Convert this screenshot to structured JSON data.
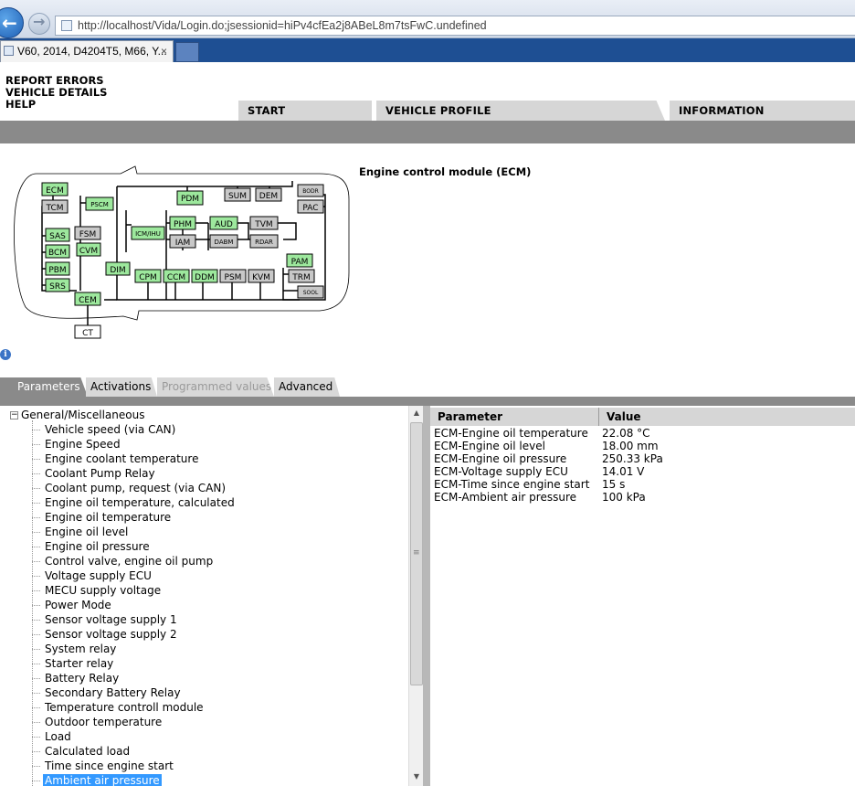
{
  "browser": {
    "url": "http://localhost/Vida/Login.do;jsessionid=hiPv4cfEa2j8ABeL8m7tsFwC.undefined",
    "tab_title": "V60, 2014, D4204T5, M66, Y...",
    "tab_close": "×"
  },
  "menu": {
    "report_errors": "REPORT ERRORS",
    "vehicle_details": "VEHICLE DETAILS",
    "help": "HELP"
  },
  "main_tabs": {
    "start": "START",
    "vehicle_profile": "VEHICLE PROFILE",
    "information": "INFORMATION"
  },
  "module_title": "Engine control module (ECM)",
  "diagram": {
    "modules": {
      "ecm": "ECM",
      "tcm": "TCM",
      "pscm": "PSCM",
      "pdm": "PDM",
      "sum": "SUM",
      "dem": "DEM",
      "bodr": "BODR",
      "pac": "PAC",
      "sas": "SAS",
      "fsm": "FSM",
      "bcm": "BCM",
      "cvm": "CVM",
      "icmihu": "ICM/IHU",
      "phm": "PHM",
      "aud": "AUD",
      "tvm": "TVM",
      "iam": "IAM",
      "dabm": "DABM",
      "rdar": "RDAR",
      "pbm": "PBM",
      "dim": "DIM",
      "srs": "SRS",
      "cpm": "CPM",
      "ccm": "CCM",
      "ddm": "DDM",
      "psm": "PSM",
      "kvm": "KVM",
      "pam": "PAM",
      "trm": "TRM",
      "sool": "SOOL",
      "cem": "CEM",
      "ct": "CT"
    },
    "colors": {
      "active": "#9de89d",
      "inactive": "#c8c8c8",
      "outline": "#000000"
    }
  },
  "info_icon": "i",
  "sub_tabs": {
    "parameters": "Parameters",
    "activations": "Activations",
    "programmed_values": "Programmed values",
    "advanced": "Advanced"
  },
  "tree": {
    "toggle": "−",
    "root": "General/Miscellaneous",
    "items": [
      "Vehicle speed (via CAN)",
      "Engine Speed",
      "Engine coolant temperature",
      "Coolant Pump Relay",
      "Coolant pump, request (via CAN)",
      "Engine oil temperature, calculated",
      "Engine oil temperature",
      "Engine oil level",
      "Engine oil pressure",
      "Control valve, engine oil pump",
      "Voltage supply ECU",
      "MECU supply voltage",
      "Power Mode",
      "Sensor voltage supply 1",
      "Sensor voltage supply 2",
      "System relay",
      "Starter relay",
      "Battery Relay",
      "Secondary Battery Relay",
      "Temperature controll module",
      "Outdoor temperature",
      "Load",
      "Calculated load",
      "Time since engine start",
      "Ambient air pressure"
    ],
    "selected_index": 24,
    "scroll_up": "▲",
    "scroll_down": "▼",
    "scroll_grip": "≡"
  },
  "values_table": {
    "headers": {
      "parameter": "Parameter",
      "value": "Value"
    },
    "rows": [
      {
        "parameter": "ECM-Engine oil temperature",
        "value": "22.08 °C"
      },
      {
        "parameter": "ECM-Engine oil level",
        "value": "18.00 mm"
      },
      {
        "parameter": "ECM-Engine oil pressure",
        "value": "250.33 kPa"
      },
      {
        "parameter": "ECM-Voltage supply ECU",
        "value": "14.01 V"
      },
      {
        "parameter": "ECM-Time since engine start",
        "value": "15 s"
      },
      {
        "parameter": "ECM-Ambient air pressure",
        "value": "100 kPa"
      }
    ]
  }
}
